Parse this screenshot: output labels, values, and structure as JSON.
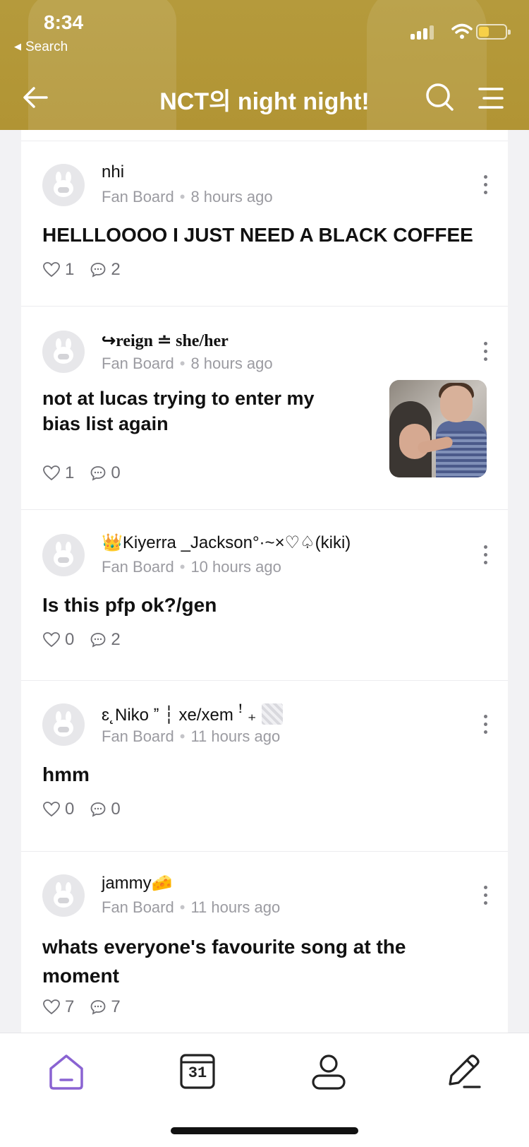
{
  "status_bar": {
    "time": "8:34",
    "back_label": "Search"
  },
  "nav": {
    "title": "NCT의 night night!"
  },
  "posts": [
    {
      "author": "nhi",
      "board": "Fan Board",
      "time": "8 hours ago",
      "title": "HELLLOOOO I JUST NEED A BLACK COFFEE",
      "likes": "1",
      "comments": "2"
    },
    {
      "author": "↪reign ≐ she/her",
      "board": "Fan Board",
      "time": "8 hours ago",
      "title": "not at lucas trying to enter my bias list again",
      "likes": "1",
      "comments": "0",
      "has_image": true
    },
    {
      "author": "👑Kiyerra _Jackson°·~×♡♤(kiki)",
      "board": "Fan Board",
      "time": "10 hours ago",
      "title": "Is this pfp ok?/gen",
      "likes": "0",
      "comments": "2"
    },
    {
      "author": "ɛ˛Niko ˮ ┆ xe/xem ꜝ ₊",
      "board": "Fan Board",
      "time": "11 hours ago",
      "title": "hmm",
      "likes": "0",
      "comments": "0"
    },
    {
      "author": "jammy🧀",
      "board": "Fan Board",
      "time": "11 hours ago",
      "title": "whats everyone's favourite song at the moment",
      "likes": "7",
      "comments": "7"
    }
  ],
  "tabbar": {
    "calendar_day": "31",
    "active_tab": "home"
  },
  "colors": {
    "header": "#b39737",
    "accent": "#8a63d2"
  }
}
